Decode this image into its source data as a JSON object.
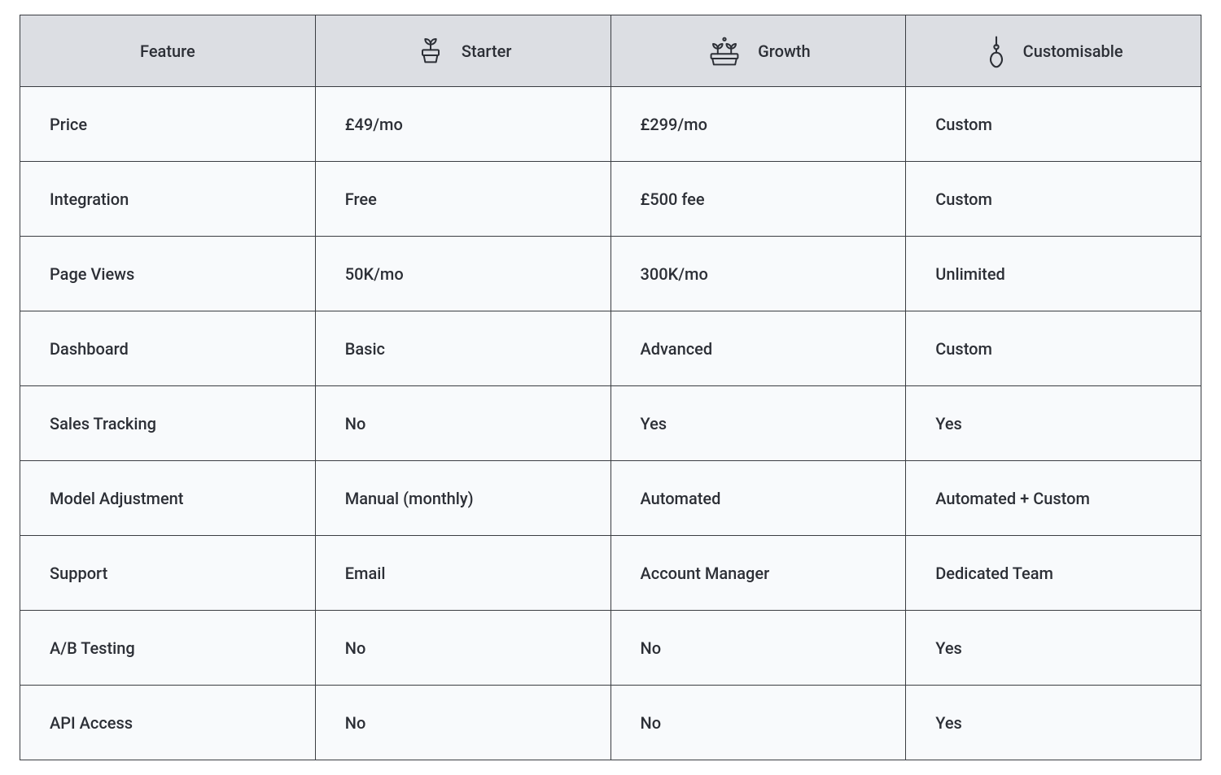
{
  "columns": {
    "feature": "Feature",
    "starter": "Starter",
    "growth": "Growth",
    "custom": "Customisable"
  },
  "icons": {
    "starter": "starter-icon",
    "growth": "growth-icon",
    "custom": "custom-icon"
  },
  "rows": [
    {
      "feature": "Price",
      "starter": "£49/mo",
      "growth": "£299/mo",
      "custom": "Custom"
    },
    {
      "feature": "Integration",
      "starter": "Free",
      "growth": "£500 fee",
      "custom": "Custom"
    },
    {
      "feature": "Page Views",
      "starter": "50K/mo",
      "growth": "300K/mo",
      "custom": "Unlimited"
    },
    {
      "feature": "Dashboard",
      "starter": "Basic",
      "growth": "Advanced",
      "custom": "Custom"
    },
    {
      "feature": "Sales Tracking",
      "starter": "No",
      "growth": "Yes",
      "custom": "Yes"
    },
    {
      "feature": "Model Adjustment",
      "starter": "Manual (monthly)",
      "growth": "Automated",
      "custom": "Automated + Custom"
    },
    {
      "feature": "Support",
      "starter": "Email",
      "growth": "Account Manager",
      "custom": "Dedicated Team"
    },
    {
      "feature": "A/B Testing",
      "starter": "No",
      "growth": "No",
      "custom": "Yes"
    },
    {
      "feature": "API Access",
      "starter": "No",
      "growth": "No",
      "custom": "Yes"
    }
  ],
  "chart_data": {
    "type": "table",
    "columns": [
      "Feature",
      "Starter",
      "Growth",
      "Customisable"
    ],
    "rows": [
      [
        "Price",
        "£49/mo",
        "£299/mo",
        "Custom"
      ],
      [
        "Integration",
        "Free",
        "£500 fee",
        "Custom"
      ],
      [
        "Page Views",
        "50K/mo",
        "300K/mo",
        "Unlimited"
      ],
      [
        "Dashboard",
        "Basic",
        "Advanced",
        "Custom"
      ],
      [
        "Sales Tracking",
        "No",
        "Yes",
        "Yes"
      ],
      [
        "Model Adjustment",
        "Manual (monthly)",
        "Automated",
        "Automated + Custom"
      ],
      [
        "Support",
        "Email",
        "Account Manager",
        "Dedicated Team"
      ],
      [
        "A/B Testing",
        "No",
        "No",
        "Yes"
      ],
      [
        "API Access",
        "No",
        "No",
        "Yes"
      ]
    ]
  }
}
